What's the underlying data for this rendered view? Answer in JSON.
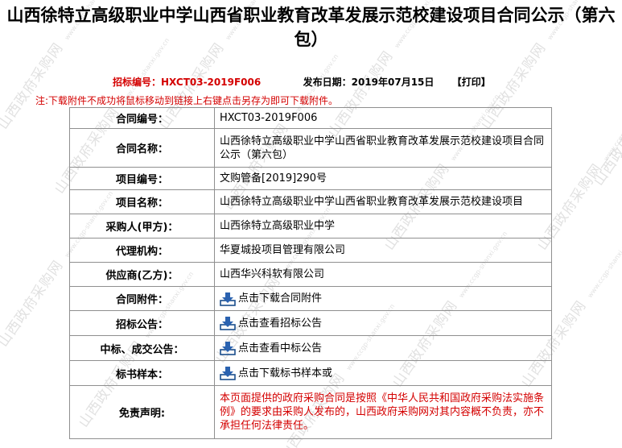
{
  "title": "山西徐特立高级职业中学山西省职业教育改革发展示范校建设项目合同公示（第六包）",
  "meta": {
    "bid_no_label": "招标编号：",
    "bid_no": "HXCT03-2019F006",
    "publish_label": "发布日期：",
    "publish_date": "2019年07月15日",
    "print_label": "【打印】"
  },
  "notice": "注:下载附件不成功将鼠标移动到链接上右键点击另存为即可下载附件。",
  "table": {
    "contract_no": {
      "label": "合同编号：",
      "value": "HXCT03-2019F006"
    },
    "contract_name": {
      "label": "合同名称：",
      "value": "山西徐特立高级职业中学山西省职业教育改革发展示范校建设项目合同公示（第六包）"
    },
    "project_no": {
      "label": "项目编号：",
      "value": "文购管备[2019]290号"
    },
    "project_name": {
      "label": "项目名称：",
      "value": "山西徐特立高级职业中学山西省职业教育改革发展示范校建设项目"
    },
    "purchaser": {
      "label": "采购人(甲方)：",
      "value": "山西徐特立高级职业中学"
    },
    "agency": {
      "label": "代理机构：",
      "value": "华夏城投项目管理有限公司"
    },
    "supplier": {
      "label": "供应商(乙方)：",
      "value": "山西华兴科软有限公司"
    },
    "attachment": {
      "label": "合同附件：",
      "link": "点击下载合同附件"
    },
    "tender_notice": {
      "label": "招标公告：",
      "link": "点击查看招标公告"
    },
    "award_notice": {
      "label": "中标、成交公告：",
      "link": "点击查看中标公告"
    },
    "sample": {
      "label": "标书样本：",
      "link": "点击下载标书样本或"
    },
    "disclaimer": {
      "label": "免责声明:",
      "value": "本页面提供的政府采购合同是按照《中华人民共和国政府采购法实施条例》的要求由采购人发布的，山西政府采购网对其内容概不负责，亦不承担任何法律责任。"
    }
  },
  "watermark": {
    "text": "山西政府采购网",
    "url": "www.ccgp-shanxi.gov.cn"
  }
}
